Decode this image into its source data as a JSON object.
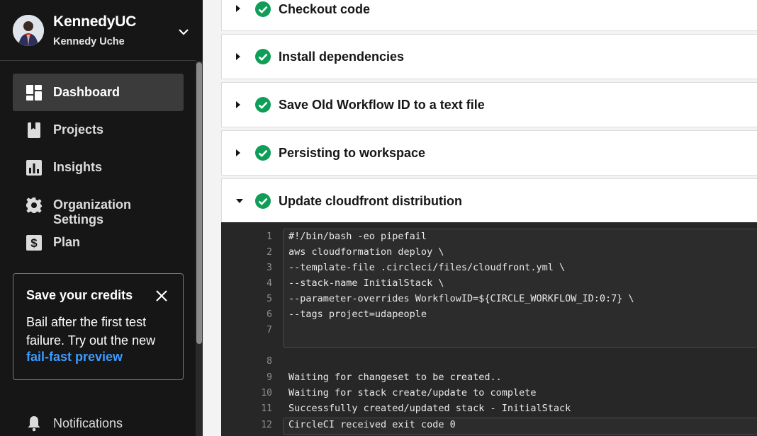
{
  "profile": {
    "name": "KennedyUC",
    "subname": "Kennedy Uche"
  },
  "nav": [
    {
      "label": "Dashboard",
      "icon": "dashboard-icon",
      "active": true
    },
    {
      "label": "Projects",
      "icon": "book-icon",
      "active": false
    },
    {
      "label": "Insights",
      "icon": "bar-chart-icon",
      "active": false
    },
    {
      "label": "Organization Settings",
      "icon": "gear-icon",
      "active": false
    },
    {
      "label": "Plan",
      "icon": "dollar-icon",
      "active": false
    }
  ],
  "credits": {
    "title": "Save your credits",
    "body": "Bail after the first test failure. Try out the new",
    "link": "fail-fast preview"
  },
  "notifications": {
    "label": "Notifications"
  },
  "steps": [
    {
      "label": "Checkout code",
      "expanded": false
    },
    {
      "label": "Install dependencies",
      "expanded": false
    },
    {
      "label": "Save Old Workflow ID to a text file",
      "expanded": false
    },
    {
      "label": "Persisting to workspace",
      "expanded": false
    },
    {
      "label": "Update cloudfront distribution",
      "expanded": true
    }
  ],
  "terminal": {
    "lines": [
      {
        "n": "1",
        "text": "#!/bin/bash -eo pipefail"
      },
      {
        "n": "2",
        "text": "aws cloudformation deploy \\"
      },
      {
        "n": "3",
        "text": "--template-file .circleci/files/cloudfront.yml \\"
      },
      {
        "n": "4",
        "text": "--stack-name InitialStack \\"
      },
      {
        "n": "5",
        "text": "--parameter-overrides WorkflowID=${CIRCLE_WORKFLOW_ID:0:7} \\"
      },
      {
        "n": "6",
        "text": "--tags project=udapeople"
      },
      {
        "n": "7",
        "text": ""
      },
      {
        "n": "8",
        "text": ""
      },
      {
        "n": "9",
        "text": "Waiting for changeset to be created.."
      },
      {
        "n": "10",
        "text": "Waiting for stack create/update to complete"
      },
      {
        "n": "11",
        "text": "Successfully created/updated stack - InitialStack"
      },
      {
        "n": "12",
        "text": "CircleCI received exit code 0"
      }
    ]
  },
  "colors": {
    "success": "#0f9d58",
    "sidebar_bg": "#161616",
    "link": "#3a9bff"
  }
}
